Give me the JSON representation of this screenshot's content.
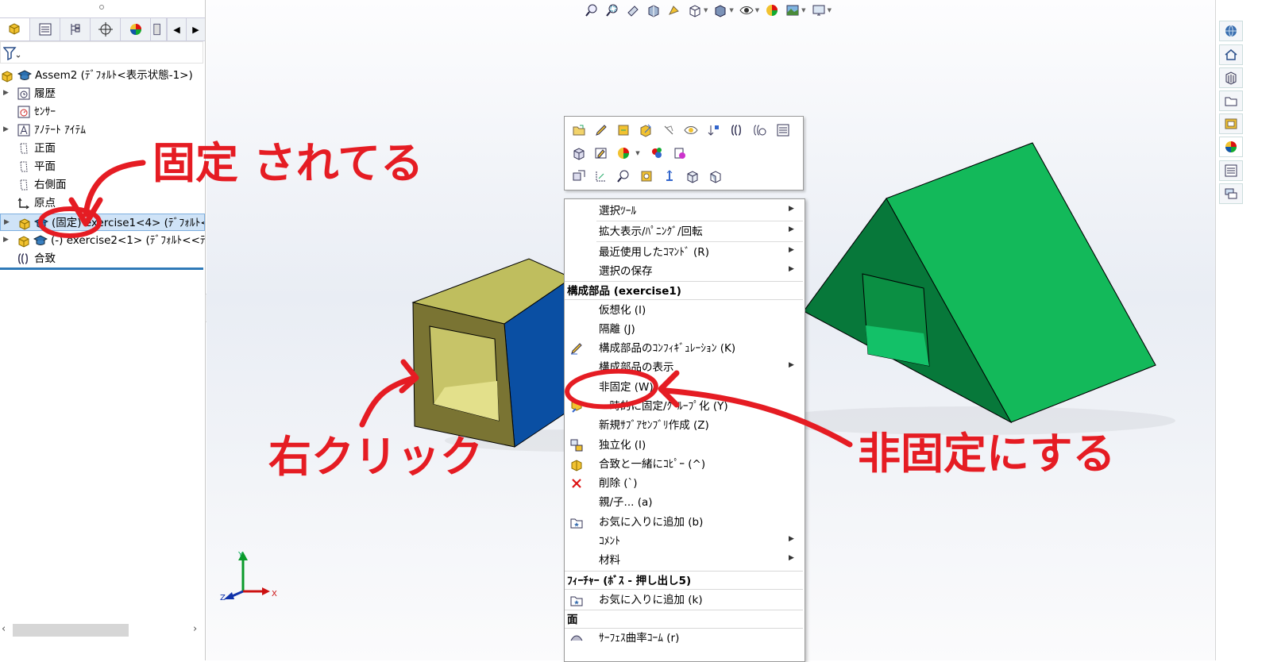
{
  "left_panel": {
    "tree": [
      {
        "label": "Assem2 (ﾃﾞﾌｫﾙﾄ<表示状態-1>)",
        "arrow": "",
        "icon": "assembly-icon"
      },
      {
        "label": "履歴",
        "arrow": "▶",
        "icon": "history-icon"
      },
      {
        "label": "ｾﾝｻｰ",
        "arrow": "",
        "icon": "sensor-icon"
      },
      {
        "label": "ｱﾉﾃｰﾄ ｱｲﾃﾑ",
        "arrow": "▶",
        "icon": "annotation-icon"
      },
      {
        "label": "正面",
        "arrow": "",
        "icon": "plane-icon"
      },
      {
        "label": "平面",
        "arrow": "",
        "icon": "plane-icon"
      },
      {
        "label": "右側面",
        "arrow": "",
        "icon": "plane-icon"
      },
      {
        "label": "原点",
        "arrow": "",
        "icon": "origin-icon"
      },
      {
        "label": "(固定) exercise1<4> (ﾃﾞﾌｫﾙﾄ<",
        "arrow": "▶",
        "icon": "part-icon"
      },
      {
        "label": "(-) exercise2<1> (ﾃﾞﾌｫﾙﾄ<<ﾃﾞ",
        "arrow": "▶",
        "icon": "part-icon"
      },
      {
        "label": "合致",
        "arrow": "",
        "icon": "mates-icon"
      }
    ]
  },
  "context_menu": {
    "items": [
      {
        "type": "item",
        "label": "選択ﾂｰﾙ",
        "sub": true,
        "icon": ""
      },
      {
        "type": "item",
        "label": "拡大表示/ﾊﾟﾆﾝｸﾞ/回転",
        "sub": true,
        "icon": ""
      },
      {
        "type": "item",
        "label": "最近使用したｺﾏﾝﾄﾞ (R)",
        "sub": true,
        "icon": ""
      },
      {
        "type": "item",
        "label": "選択の保存",
        "sub": true,
        "icon": ""
      },
      {
        "type": "header",
        "label": "構成部品 (exercise1)"
      },
      {
        "type": "item",
        "label": "仮想化 (I)",
        "sub": false,
        "icon": ""
      },
      {
        "type": "item",
        "label": "隔離 (J)",
        "sub": false,
        "icon": ""
      },
      {
        "type": "item",
        "label": "構成部品のｺﾝﾌｨｷﾞｭﾚｰｼｮﾝ (K)",
        "sub": false,
        "icon": "config-icon"
      },
      {
        "type": "item",
        "label": "構成部品の表示",
        "sub": true,
        "icon": ""
      },
      {
        "type": "item",
        "label": "非固定 (W)",
        "sub": false,
        "icon": ""
      },
      {
        "type": "item",
        "label": "一時的に固定/ｸﾞﾙｰﾌﾟ化 (Y)",
        "sub": false,
        "icon": "temp-fix-icon"
      },
      {
        "type": "item",
        "label": "新規ｻﾌﾞｱｾﾝﾌﾞﾘ作成 (Z)",
        "sub": false,
        "icon": ""
      },
      {
        "type": "item",
        "label": "独立化 (I)",
        "sub": false,
        "icon": "independent-icon"
      },
      {
        "type": "item",
        "label": "合致と一緒にｺﾋﾟｰ (^)",
        "sub": false,
        "icon": "copy-mates-icon"
      },
      {
        "type": "item",
        "label": "削除 (`)",
        "sub": false,
        "icon": "delete-icon"
      },
      {
        "type": "item",
        "label": "親/子... (a)",
        "sub": false,
        "icon": ""
      },
      {
        "type": "item",
        "label": "お気に入りに追加 (b)",
        "sub": false,
        "icon": "favorite-icon"
      },
      {
        "type": "item",
        "label": "ｺﾒﾝﾄ",
        "sub": true,
        "icon": ""
      },
      {
        "type": "item",
        "label": "材料",
        "sub": true,
        "icon": ""
      },
      {
        "type": "header",
        "label": "ﾌｨｰﾁｬｰ (ﾎﾞｽ - 押し出し5)"
      },
      {
        "type": "item",
        "label": "お気に入りに追加 (k)",
        "sub": false,
        "icon": "favorite-icon"
      },
      {
        "type": "header",
        "label": "面"
      },
      {
        "type": "item",
        "label": "ｻｰﾌｪｽ曲率ｺｰﾑ (r)",
        "sub": false,
        "icon": "surface-icon"
      }
    ]
  },
  "triad": {
    "x": "X",
    "y": "Y",
    "z": "Z"
  },
  "annotations": {
    "fixed_note": "固定 されてる",
    "right_click_note": "右クリック",
    "unfix_note": "非固定にする"
  },
  "colors": {
    "annotation": "#e51c23",
    "selection": "#cfe3f7",
    "box_face": "#c2c05e",
    "box_side": "#0a4fa3",
    "prism": "#0aa34a"
  }
}
